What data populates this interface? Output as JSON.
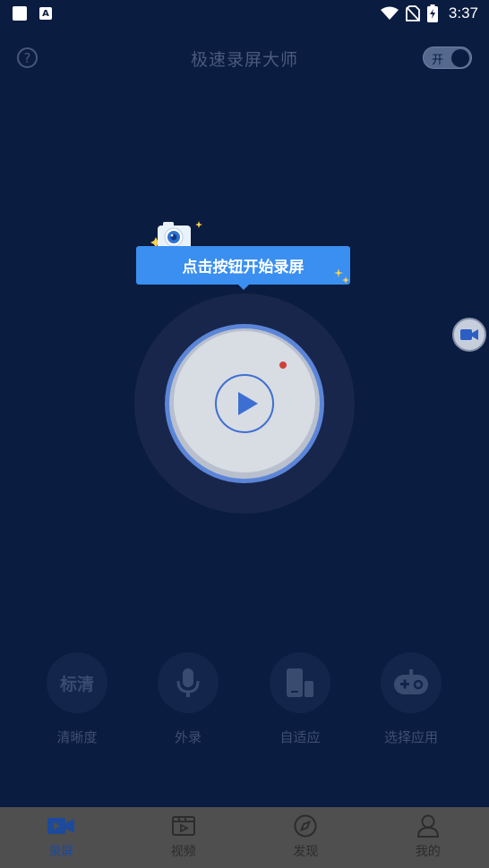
{
  "status_bar": {
    "time": "3:37",
    "notif_letter": "A"
  },
  "header": {
    "title": "极速录屏大师",
    "help_symbol": "?",
    "toggle_label": "开"
  },
  "tooltip": {
    "text": "点击按钮开始录屏"
  },
  "options": [
    {
      "icon_text": "标清",
      "label": "清晰度",
      "icon": "quality-icon"
    },
    {
      "icon_text": "",
      "label": "外录",
      "icon": "microphone-icon"
    },
    {
      "icon_text": "",
      "label": "自适应",
      "icon": "orientation-icon"
    },
    {
      "icon_text": "",
      "label": "选择应用",
      "icon": "gamepad-icon"
    }
  ],
  "bottom_nav": [
    {
      "label": "录屏",
      "icon": "video-camera-icon",
      "active": true
    },
    {
      "label": "视频",
      "icon": "film-icon",
      "active": false
    },
    {
      "label": "发现",
      "icon": "compass-icon",
      "active": false
    },
    {
      "label": "我的",
      "icon": "person-icon",
      "active": false
    }
  ],
  "colors": {
    "background": "#0a1c40",
    "accent": "#3a8ff0",
    "nav_active": "#1d4a9a",
    "nav_bg": "#4f4f50"
  }
}
